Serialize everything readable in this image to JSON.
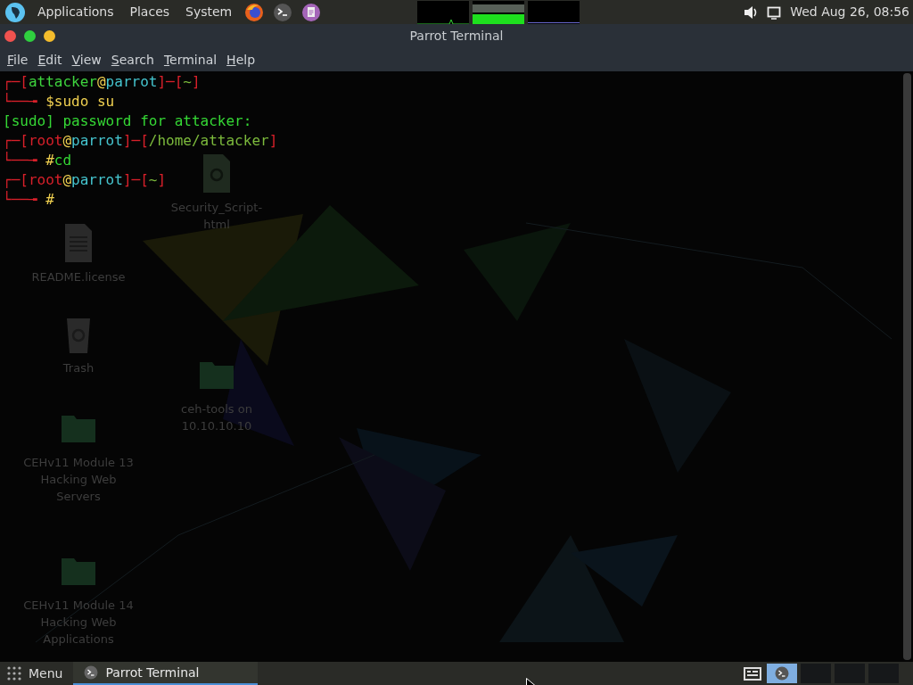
{
  "top_panel": {
    "menus": [
      "Applications",
      "Places",
      "System"
    ],
    "clock": "Wed Aug 26, 08:56"
  },
  "window": {
    "title": "Parrot Terminal",
    "menu": [
      "File",
      "Edit",
      "View",
      "Search",
      "Terminal",
      "Help"
    ]
  },
  "desktop_icons": [
    {
      "label": "Security_Script-html",
      "kind": "script"
    },
    {
      "label": "README.license",
      "kind": "document"
    },
    {
      "label": "ceh-tools on 10.10.10.10",
      "kind": "share"
    },
    {
      "label": "Trash",
      "kind": "trash"
    },
    {
      "label": "CEHv11 Module 13 Hacking Web Servers",
      "kind": "folder"
    },
    {
      "label": "CEHv11 Module 14 Hacking Web Applications",
      "kind": "folder"
    }
  ],
  "terminal": {
    "lines": [
      [
        {
          "text": "┌─[",
          "kind": "frame"
        },
        {
          "text": "attacker",
          "kind": "user"
        },
        {
          "text": "@",
          "kind": "at"
        },
        {
          "text": "parrot",
          "kind": "host"
        },
        {
          "text": "]─[",
          "kind": "frame"
        },
        {
          "text": "~",
          "kind": "path"
        },
        {
          "text": "]",
          "kind": "frame"
        }
      ],
      [
        {
          "text": "└──╼ ",
          "kind": "frame"
        },
        {
          "text": "$",
          "kind": "prompt"
        },
        {
          "text": "sudo su",
          "kind": "command"
        }
      ],
      [
        {
          "text": "[sudo] password for attacker:",
          "kind": "output"
        }
      ],
      [
        {
          "text": "┌─[",
          "kind": "frame"
        },
        {
          "text": "root",
          "kind": "root"
        },
        {
          "text": "@",
          "kind": "at"
        },
        {
          "text": "parrot",
          "kind": "host"
        },
        {
          "text": "]─[",
          "kind": "frame"
        },
        {
          "text": "/home/attacker",
          "kind": "path"
        },
        {
          "text": "]",
          "kind": "frame"
        }
      ],
      [
        {
          "text": "└──╼ ",
          "kind": "frame"
        },
        {
          "text": "#",
          "kind": "prompt"
        },
        {
          "text": "cd",
          "kind": "output"
        }
      ],
      [
        {
          "text": "┌─[",
          "kind": "frame"
        },
        {
          "text": "root",
          "kind": "root"
        },
        {
          "text": "@",
          "kind": "at"
        },
        {
          "text": "parrot",
          "kind": "host"
        },
        {
          "text": "]─[",
          "kind": "frame"
        },
        {
          "text": "~",
          "kind": "path"
        },
        {
          "text": "]",
          "kind": "frame"
        }
      ],
      [
        {
          "text": "└──╼ ",
          "kind": "frame"
        },
        {
          "text": "#",
          "kind": "prompt"
        }
      ]
    ]
  },
  "taskbar": {
    "menu_label": "Menu",
    "tasks": [
      {
        "label": "Parrot Terminal",
        "selected": true
      }
    ],
    "workspaces": [
      {
        "selected": true
      },
      {
        "selected": false
      },
      {
        "selected": false
      },
      {
        "selected": false
      }
    ]
  }
}
